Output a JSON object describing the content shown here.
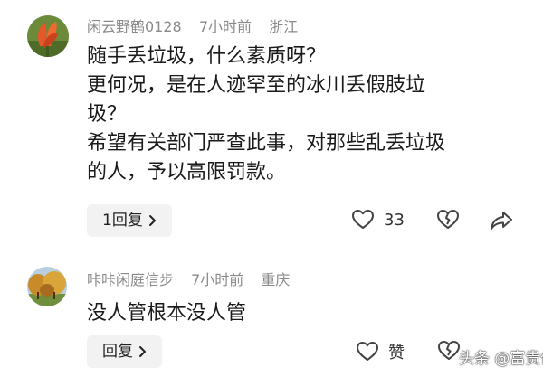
{
  "comments": [
    {
      "username": "闲云野鹤0128",
      "time": "7小时前",
      "location": "浙江",
      "avatar_icon": "red-flower-avatar",
      "lines": [
        "随手丢垃圾，什么素质呀？",
        "更何况，是在人迹罕至的冰川丢假肢垃",
        "圾？",
        "希望有关部门严查此事，对那些乱丢垃圾",
        "的人，予以高限罚款。"
      ],
      "reply_label": "1回复",
      "like_count": "33"
    },
    {
      "username": "咔咔闲庭信步",
      "time": "7小时前",
      "location": "重庆",
      "avatar_icon": "tree-landscape-avatar",
      "lines": [
        "没人管根本没人管"
      ],
      "reply_label": "回复",
      "like_label": "赞"
    }
  ],
  "watermark": "头条 @富贵仙",
  "colors": {
    "meta_gray": "#8a8a8a",
    "text": "#1a1a1a",
    "button_bg": "#f2f2f2"
  }
}
